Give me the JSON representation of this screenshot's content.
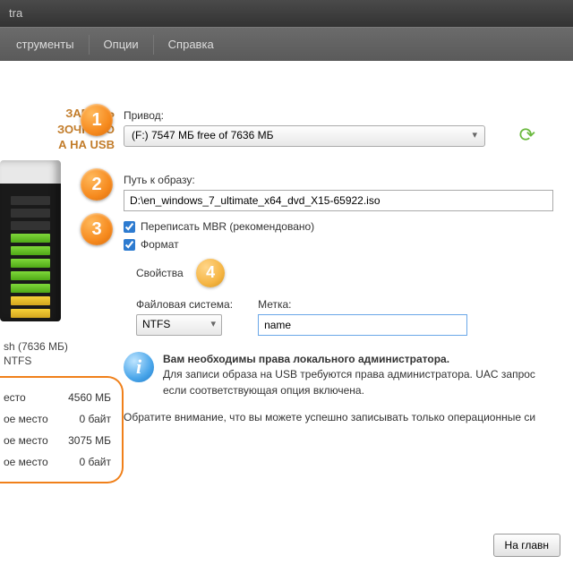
{
  "title": "tra",
  "menu": {
    "tools": "струменты",
    "options": "Опции",
    "help": "Справка"
  },
  "heading": {
    "l1": "ЗАПИСЬ",
    "l2": "ЗОЧНОГО",
    "l3": "А НА USB"
  },
  "drive": {
    "name": "sh (7636 МБ)",
    "fs": "NTFS"
  },
  "stats": [
    {
      "label": "есто",
      "value": "4560 МБ"
    },
    {
      "label": "ое место",
      "value": "0 байт"
    },
    {
      "label": "ое место",
      "value": "3075 МБ"
    },
    {
      "label": "ое место",
      "value": "0 байт"
    }
  ],
  "step1": {
    "label": "Привод:",
    "value": "(F:) 7547 МБ free of 7636 МБ"
  },
  "step2": {
    "label": "Путь к образу:",
    "value": "D:\\en_windows_7_ultimate_x64_dvd_X15-65922.iso"
  },
  "step3": {
    "mbr": "Переписать MBR (рекомендовано)",
    "format": "Формат"
  },
  "step4": {
    "heading": "Свойства",
    "fs_label": "Файловая система:",
    "fs_value": "NTFS",
    "vol_label": "Метка:",
    "vol_value": "name"
  },
  "info": {
    "bold": "Вам необходимы права локального администратора.",
    "line": "Для записи образа на USB требуются права администратора. UAC запрос",
    "line2": "если соответствующая опция включена."
  },
  "note": "Обратите внимание, что вы можете успешно записывать только операционные си",
  "button": "На главн"
}
